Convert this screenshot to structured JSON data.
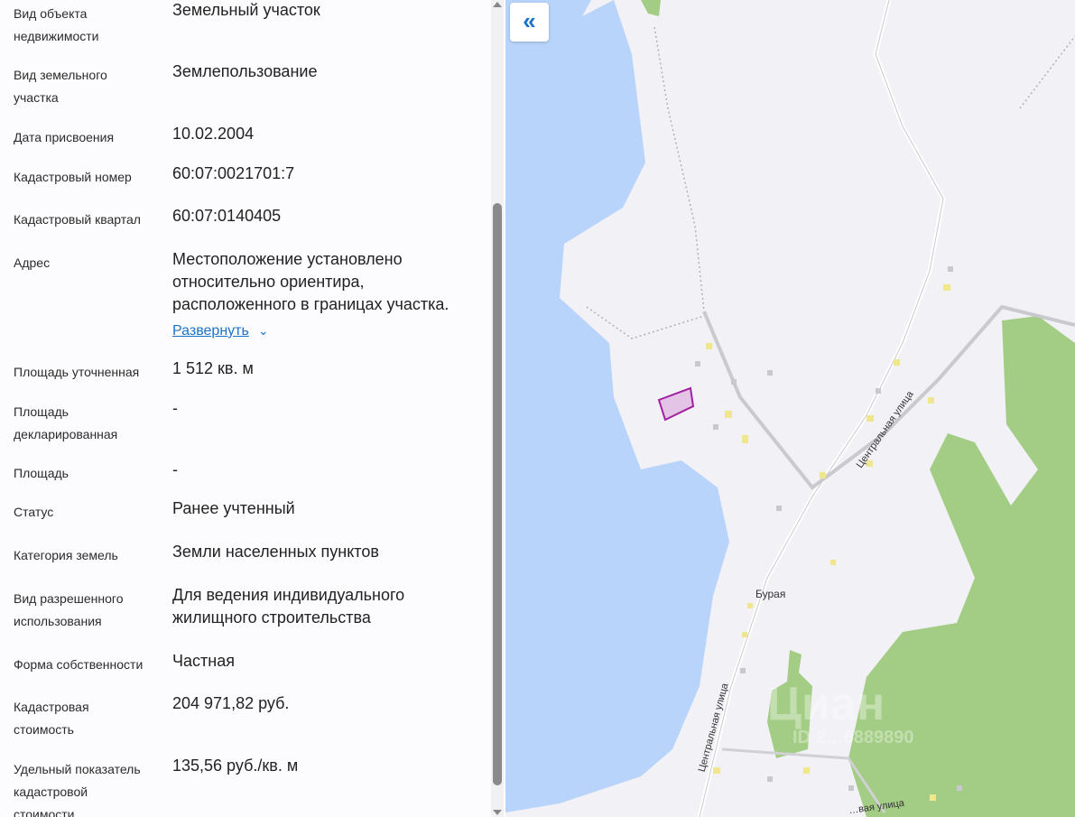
{
  "fields": [
    {
      "label": "Вид объекта недвижимости",
      "value": "Земельный участок"
    },
    {
      "label": "Вид земельного участка",
      "value": "Землепользование"
    },
    {
      "label": "Дата присвоения",
      "value": "10.02.2004"
    },
    {
      "label": "Кадастровый номер",
      "value": "60:07:0021701:7"
    },
    {
      "label": "Кадастровый квартал",
      "value": "60:07:0140405"
    },
    {
      "label": "Адрес",
      "value": "Местоположение установлено относительно ориентира, расположенного в границах участка."
    },
    {
      "label": "Площадь уточненная",
      "value": "1 512 кв. м"
    },
    {
      "label": "Площадь декларированная",
      "value": "-"
    },
    {
      "label": "Площадь",
      "value": "-"
    },
    {
      "label": "Статус",
      "value": "Ранее учтенный"
    },
    {
      "label": "Категория земель",
      "value": "Земли населенных пунктов"
    },
    {
      "label": "Вид разрешенного использования",
      "value": "Для ведения индивидуального жилищного строительства"
    },
    {
      "label": "Форма собственности",
      "value": "Частная"
    },
    {
      "label": "Кадастровая стоимость",
      "value": "204 971,82 руб."
    },
    {
      "label": "Удельный показатель кадастровой стоимости",
      "value": "135,56 руб./кв. м"
    }
  ],
  "expand_label": "Развернуть",
  "map": {
    "collapse_icon": "«",
    "labels": {
      "village": "Бурая",
      "street1": "Центральная улица",
      "street2": "Центральная улица",
      "street3": "…вая улица"
    },
    "watermark": "Циан",
    "watermark_id": "ID 2…6889890",
    "colors": {
      "water": "#b8d4fa",
      "forest": "#a3cc84",
      "land": "#f2f1f6",
      "plot": "#a020a0"
    }
  }
}
